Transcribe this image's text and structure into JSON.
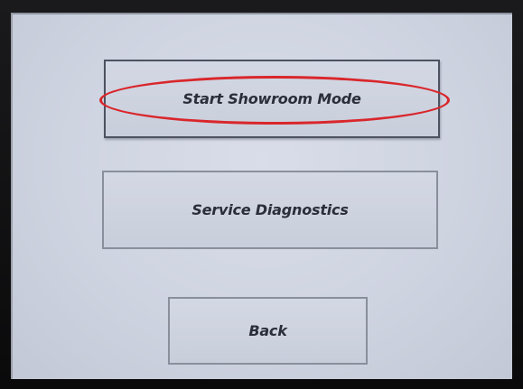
{
  "menu": {
    "buttons": [
      {
        "label": "Start Showroom Mode"
      },
      {
        "label": "Service Diagnostics"
      },
      {
        "label": "Back"
      }
    ]
  },
  "annotation": {
    "highlight_color": "#d9262b",
    "highlighted_item": "Start Showroom Mode"
  },
  "colors": {
    "screen_background": "#d9dde9",
    "button_text": "#2a2d3a",
    "bezel": "#0c0c0e"
  }
}
